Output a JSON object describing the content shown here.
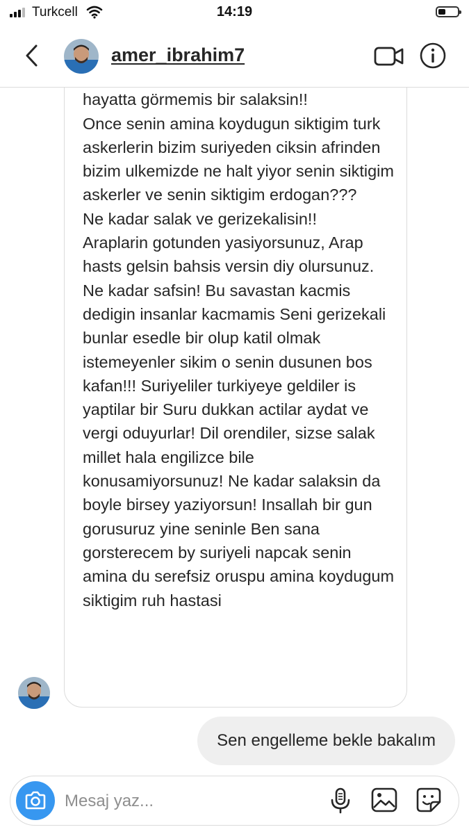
{
  "status_bar": {
    "carrier": "Turkcell",
    "time": "14:19"
  },
  "header": {
    "username": "amer_ibrahim7"
  },
  "messages": {
    "incoming_text": "Cok belli hic ogrenmemis okula\nhayatta görmemis bir salaksin!!\nOnce senin amina koydugun siktigim turk askerlerin bizim suriyeden ciksin afrinden bizim ulkemizde ne halt yiyor senin siktigim askerler ve senin siktigim erdogan???\nNe kadar salak ve gerizekalisin!!\nAraplarin gotunden yasiyorsunuz, Arap hasts gelsin bahsis versin diy olursunuz. Ne kadar safsin! Bu savastan kacmis dedigin insanlar kacmamis Seni gerizekali bunlar esedle bir olup katil olmak istemeyenler sikim o senin dusunen bos kafan!!! Suriyeliler turkiyeye geldiler is yaptilar bir Suru dukkan actilar aydat ve vergi oduyurlar! Dil orendiler, sizse salak millet hala engilizce bile konusamiyorsunuz!  Ne kadar salaksin da boyle birsey yaziyorsun! Insallah bir gun gorusuruz yine seninle Ben sana gorsterecem by suriyeli napcak senin amina du serefsiz oruspu amina koydugum siktigim ruh hastasi",
    "outgoing_text": "Sen engelleme bekle bakalım"
  },
  "composer": {
    "placeholder": "Mesaj yaz..."
  },
  "colors": {
    "accent": "#3797f0",
    "outgoing_bubble": "#efefef",
    "border": "#dbdbdb"
  }
}
